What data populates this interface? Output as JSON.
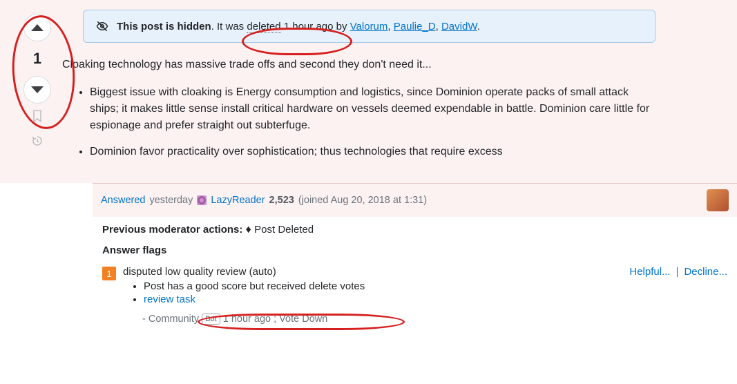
{
  "vote": {
    "score": "1"
  },
  "notice": {
    "prefix_bold": "This post is hidden",
    "middle": ". It was ",
    "deleted_word": "deleted",
    "time": " 1 hour ago by ",
    "users": [
      "Valorum",
      "Paulie_D",
      "DavidW"
    ],
    "period": "."
  },
  "body": {
    "lead": "Cloaking technology has massive trade offs and second they don't need it...",
    "bullets": [
      "Biggest issue with cloaking is Energy consumption and logistics, since Dominion operate packs of small attack ships; it makes little sense install critical hardware on vessels deemed expendable in battle. Dominion care little for espionage and prefer straight out subterfuge.",
      "Dominion favor practicality over sophistication; thus technologies that require excess"
    ]
  },
  "meta": {
    "answered": "Answered",
    "when": "yesterday",
    "user": "LazyReader",
    "rep": "2,523",
    "joined": "(joined Aug 20, 2018 at 1:31)"
  },
  "modbar": {
    "label": "Previous moderator actions:",
    "action": "Post Deleted"
  },
  "flags": {
    "title": "Answer flags",
    "count": "1",
    "main": "disputed low quality review (auto)",
    "subs": [
      "Post has a good score but received delete votes",
      "review task"
    ],
    "helpful": "Helpful...",
    "decline": "Decline...",
    "community_prefix": "- ",
    "community": "Community",
    "bot": "Bot",
    "community_time": "1 hour ago ; Vote Down"
  }
}
